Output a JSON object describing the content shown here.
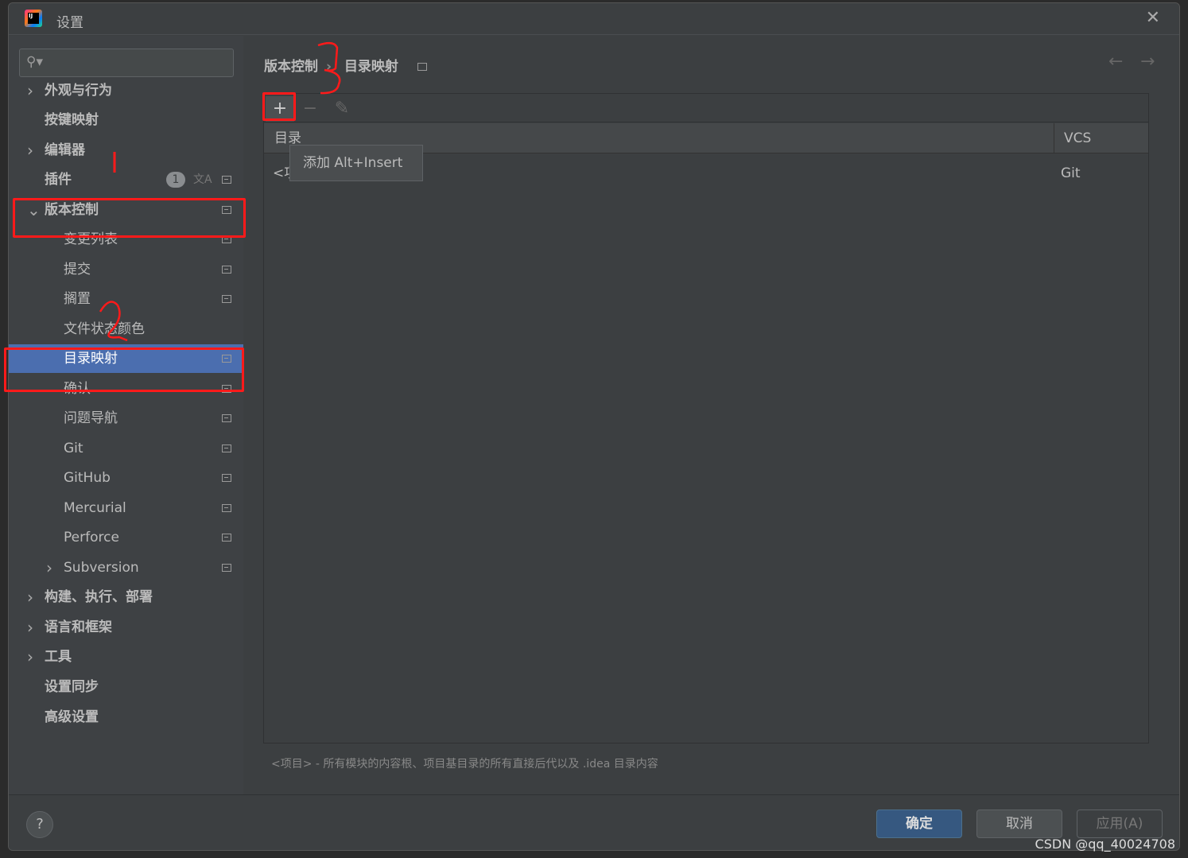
{
  "window": {
    "title": "设置",
    "close_icon": "close-icon"
  },
  "search": {
    "placeholder": ""
  },
  "sidebar": {
    "items": [
      {
        "label": "外观与行为",
        "expandable": true,
        "bold": true
      },
      {
        "label": "按键映射",
        "bold": true
      },
      {
        "label": "编辑器",
        "expandable": true,
        "bold": true
      },
      {
        "label": "插件",
        "bold": true,
        "badge": "1"
      },
      {
        "label": "版本控制",
        "expanded": true,
        "bold": true
      },
      {
        "label": "变更列表"
      },
      {
        "label": "提交"
      },
      {
        "label": "搁置"
      },
      {
        "label": "文件状态颜色"
      },
      {
        "label": "目录映射",
        "selected": true
      },
      {
        "label": "确认"
      },
      {
        "label": "问题导航"
      },
      {
        "label": "Git"
      },
      {
        "label": "GitHub"
      },
      {
        "label": "Mercurial"
      },
      {
        "label": "Perforce"
      },
      {
        "label": "Subversion",
        "expandable": true
      },
      {
        "label": "构建、执行、部署",
        "expandable": true,
        "bold": true
      },
      {
        "label": "语言和框架",
        "expandable": true,
        "bold": true
      },
      {
        "label": "工具",
        "expandable": true,
        "bold": true
      },
      {
        "label": "设置同步",
        "bold": true
      },
      {
        "label": "高级设置",
        "bold": true
      }
    ]
  },
  "main": {
    "breadcrumb": [
      "版本控制",
      "目录映射"
    ],
    "toolbar": {
      "add": "+",
      "remove": "−",
      "edit": "✎"
    },
    "table": {
      "columns": [
        "目录",
        "VCS"
      ],
      "rows": [
        {
          "directory": "<项目>",
          "vcs": "Git"
        }
      ]
    },
    "tooltip": "添加  Alt+Insert",
    "hint": "<项目> - 所有模块的内容根、项目基目录的所有直接后代以及 .idea 目录内容"
  },
  "footer": {
    "help": "?",
    "ok": "确定",
    "cancel": "取消",
    "apply": "应用(A)"
  },
  "watermark": "CSDN @qq_40024708",
  "annotations": {
    "color": "#ff1a1a",
    "marks": [
      "2",
      "3"
    ]
  }
}
